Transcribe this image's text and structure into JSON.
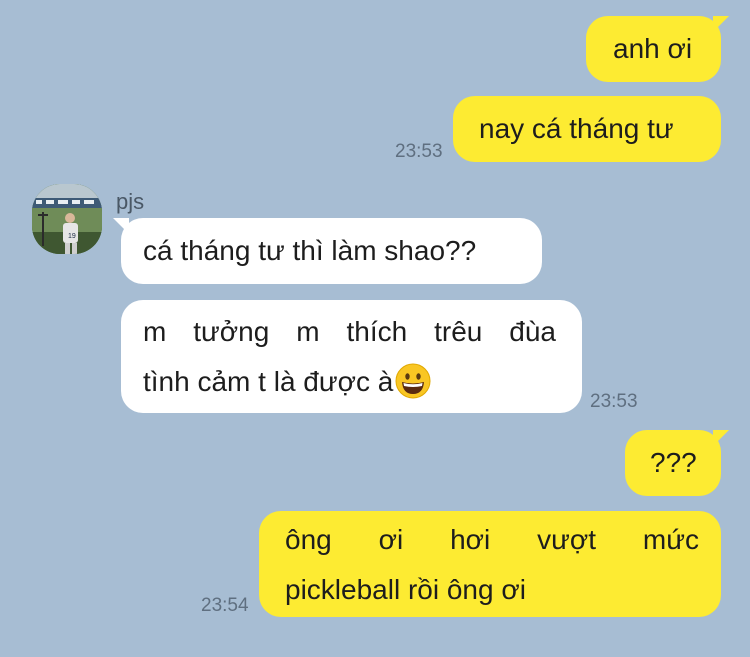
{
  "messages": {
    "m1": {
      "text": "anh ơi"
    },
    "m2": {
      "text": "nay cá tháng tư",
      "time": "23:53"
    },
    "sender": {
      "name": "pjs"
    },
    "m3": {
      "text": "cá tháng tư thì làm shao??"
    },
    "m4": {
      "line1": "m tưởng m thích trêu đùa",
      "line2": "tình cảm t là được à",
      "emoji": "grinning-face",
      "time": "23:53"
    },
    "m5": {
      "text": "???"
    },
    "m6": {
      "line1": "ông ơi hơi vượt mức",
      "line2": "pickleball rồi ông ơi",
      "time": "23:54"
    }
  },
  "colors": {
    "background": "#a7bdd3",
    "outgoing_bubble": "#fdeb32",
    "incoming_bubble": "#ffffff",
    "timestamp": "#5f6f80"
  }
}
